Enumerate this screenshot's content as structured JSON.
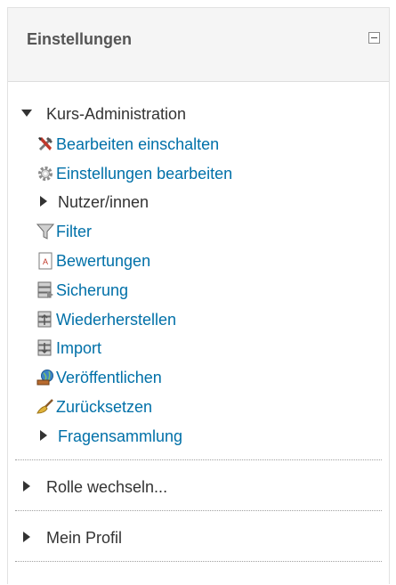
{
  "block": {
    "title": "Einstellungen",
    "collapse_icon": "minus-box-icon"
  },
  "course_admin": {
    "label": "Kurs-Administration",
    "items": [
      {
        "label": "Bearbeiten einschalten",
        "icon": "tools-icon"
      },
      {
        "label": "Einstellungen bearbeiten",
        "icon": "gear-icon"
      },
      {
        "label": "Nutzer/innen",
        "icon": "expand-triangle"
      },
      {
        "label": "Filter",
        "icon": "filter-icon"
      },
      {
        "label": "Bewertungen",
        "icon": "grades-icon"
      },
      {
        "label": "Sicherung",
        "icon": "backup-icon"
      },
      {
        "label": "Wiederherstellen",
        "icon": "restore-icon"
      },
      {
        "label": "Import",
        "icon": "import-icon"
      },
      {
        "label": "Veröffentlichen",
        "icon": "publish-icon"
      },
      {
        "label": "Zurücksetzen",
        "icon": "broom-icon"
      },
      {
        "label": "Fragensammlung",
        "icon": "expand-triangle"
      }
    ]
  },
  "switch_role": {
    "label": "Rolle wechseln..."
  },
  "my_profile": {
    "label": "Mein Profil"
  },
  "colors": {
    "link": "#0070a8",
    "text": "#333333",
    "header_bg": "#f5f5f5"
  }
}
